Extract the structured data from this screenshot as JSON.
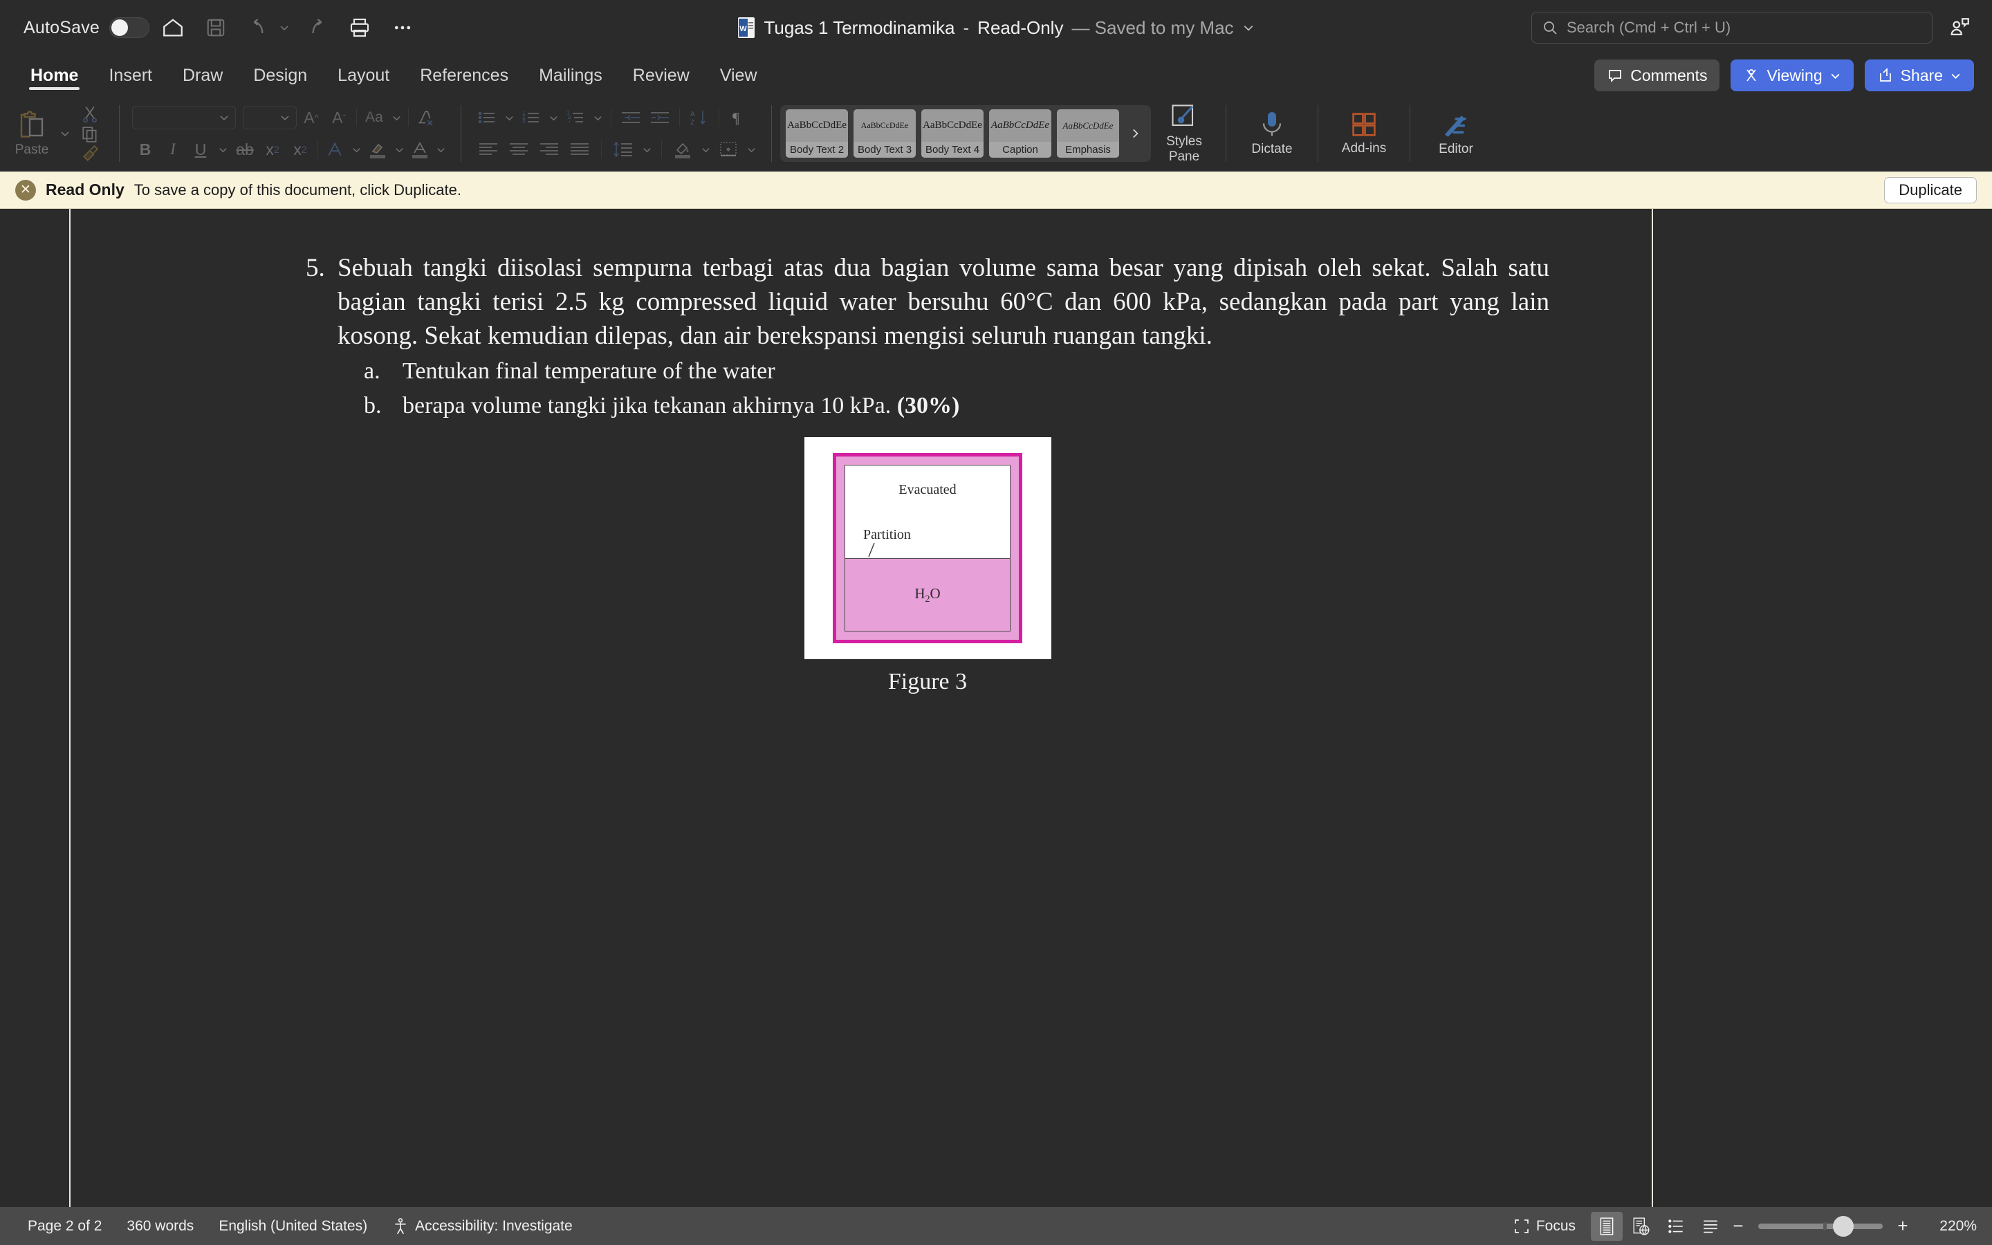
{
  "titlebar": {
    "autosave_label": "AutoSave",
    "autosave_state": "off",
    "doc_name": "Tugas 1 Termodinamika",
    "separator": "-",
    "read_only_tag": "Read-Only",
    "saved_state": "— Saved to my Mac",
    "icons": [
      "home-icon",
      "save-icon",
      "undo-icon",
      "redo-icon",
      "print-icon",
      "more-options-icon"
    ],
    "search_placeholder": "Search (Cmd + Ctrl + U)"
  },
  "tabs": [
    {
      "label": "Home",
      "active": true
    },
    {
      "label": "Insert",
      "active": false
    },
    {
      "label": "Draw",
      "active": false
    },
    {
      "label": "Design",
      "active": false
    },
    {
      "label": "Layout",
      "active": false
    },
    {
      "label": "References",
      "active": false
    },
    {
      "label": "Mailings",
      "active": false
    },
    {
      "label": "Review",
      "active": false
    },
    {
      "label": "View",
      "active": false
    }
  ],
  "tabbar_actions": {
    "comments": "Comments",
    "viewing": "Viewing",
    "share": "Share"
  },
  "ribbon": {
    "paste_label": "Paste",
    "font_name_value": "",
    "font_size_value": "",
    "change_case_label": "Aa",
    "bold": "B",
    "italic": "I",
    "underline": "U",
    "strikethrough": "ab",
    "subscript": "x₂",
    "superscript": "x²",
    "styles": [
      {
        "sample": "AaBbCcDdEe",
        "name": "Body Text 2"
      },
      {
        "sample": "AaBbCcDdEe",
        "name": "Body Text 3"
      },
      {
        "sample": "AaBbCcDdEe",
        "name": "Body Text 4"
      },
      {
        "sample": "AaBbCcDdEe",
        "name": "Caption"
      },
      {
        "sample": "AaBbCcDdEe",
        "name": "Emphasis"
      }
    ],
    "styles_pane_label": "Styles\nPane",
    "styles_pane_line1": "Styles",
    "styles_pane_line2": "Pane",
    "dictate_label": "Dictate",
    "addins_label": "Add-ins",
    "editor_label": "Editor"
  },
  "readonly_bar": {
    "title": "Read Only",
    "message": "To save a copy of this document, click Duplicate.",
    "duplicate_label": "Duplicate"
  },
  "document": {
    "question_number": "5.",
    "question_text": "Sebuah tangki diisolasi sempurna terbagi atas dua bagian volume sama besar yang dipisah oleh sekat. Salah satu bagian tangki terisi 2.5 kg compressed liquid water bersuhu 60°C dan 600 kPa, sedangkan pada part yang lain kosong. Sekat kemudian dilepas, dan air berekspansi mengisi seluruh ruangan tangki.",
    "sub_a_label": "a.",
    "sub_a_text": "Tentukan  final temperature of the water",
    "sub_b_label": "b.",
    "sub_b_text": "berapa volume tangki jika tekanan akhirnya 10 kPa.",
    "sub_b_bold": "(30%)",
    "figure": {
      "label_evacuated": "Evacuated",
      "label_partition": "Partition",
      "label_h2o_main": "H",
      "label_h2o_sub": "2",
      "label_h2o_tail": "O",
      "caption": "Figure 3",
      "border_color": "#d41fa0",
      "fill_color": "#e8a0d8"
    }
  },
  "statusbar": {
    "page_info": "Page 2 of 2",
    "word_count": "360 words",
    "language": "English (United States)",
    "accessibility": "Accessibility: Investigate",
    "focus_label": "Focus",
    "zoom_level": "220%",
    "zoom_minus": "−",
    "zoom_plus": "+"
  },
  "colors": {
    "chrome_bg": "#2b2b2b",
    "accent_blue": "#4a6ee0",
    "banner_bg": "#faf3dc",
    "statusbar_bg": "#4a4a4a"
  }
}
